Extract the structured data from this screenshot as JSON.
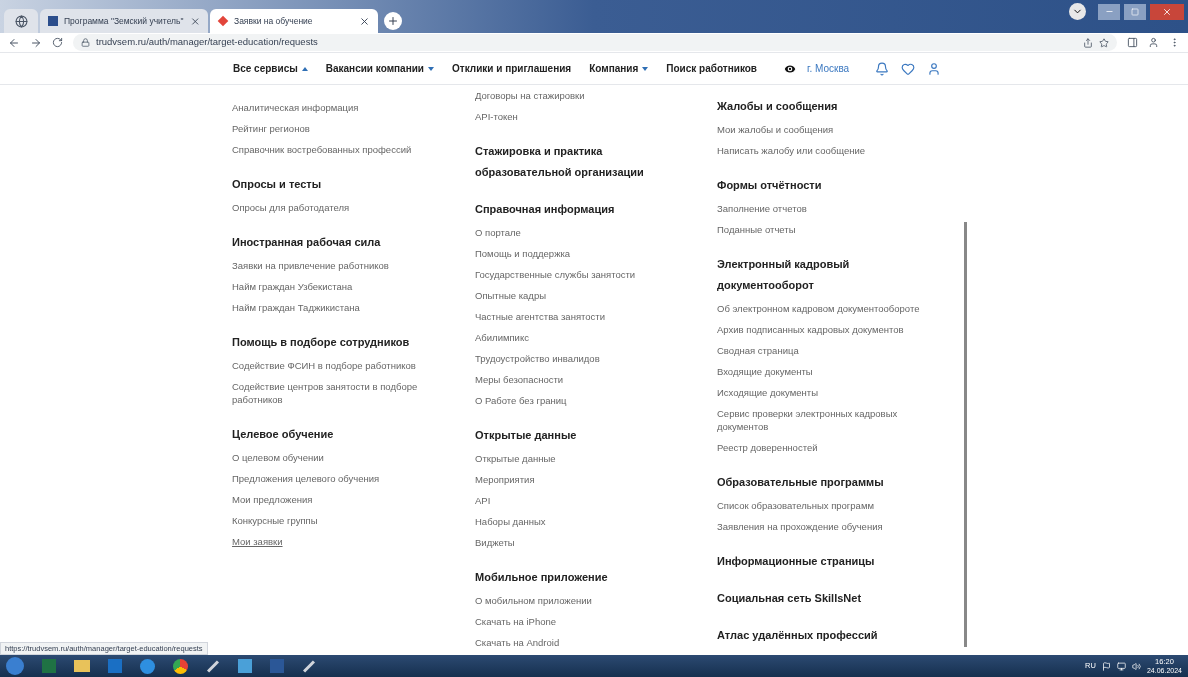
{
  "browser": {
    "tabs": [
      {
        "kind": "pinned",
        "selected": false
      },
      {
        "kind": "page",
        "title": "Программа \"Земский учитель\"",
        "selected": false
      },
      {
        "kind": "page",
        "title": "Заявки на обучение",
        "selected": true
      }
    ],
    "address": "trudvsem.ru/auth/manager/target-education/requests"
  },
  "nav": {
    "items": [
      {
        "kind": "menu",
        "label": "Все сервисы",
        "expanded": true
      },
      {
        "kind": "menu",
        "label": "Вакансии компании",
        "expanded": false
      },
      {
        "kind": "link",
        "label": "Отклики и приглашения"
      },
      {
        "kind": "menu",
        "label": "Компания",
        "expanded": false
      },
      {
        "kind": "link",
        "label": "Поиск работников"
      }
    ],
    "city": "г. Москва"
  },
  "columns": [
    [
      {
        "links": [
          {
            "label": "Аналитическая информация",
            "selected": false
          },
          {
            "label": "Рейтинг регионов",
            "selected": false
          },
          {
            "label": "Справочник востребованных профессий",
            "selected": false
          }
        ]
      },
      {
        "heading": "Опросы и тесты",
        "links": [
          {
            "label": "Опросы для работодателя",
            "selected": false
          }
        ]
      },
      {
        "heading": "Иностранная рабочая сила",
        "links": [
          {
            "label": "Заявки на привлечение работников",
            "selected": false
          },
          {
            "label": "Найм граждан Узбекистана",
            "selected": false
          },
          {
            "label": "Найм граждан Таджикистана",
            "selected": false
          }
        ]
      },
      {
        "heading": "Помощь в подборе сотрудников",
        "links": [
          {
            "label": "Содействие ФСИН в подборе работников",
            "selected": false
          },
          {
            "label": "Содействие центров занятости в подборе работников",
            "selected": false
          }
        ]
      },
      {
        "heading": "Целевое обучение",
        "links": [
          {
            "label": "О целевом обучении",
            "selected": false
          },
          {
            "label": "Предложения целевого обучения",
            "selected": false
          },
          {
            "label": "Мои предложения",
            "selected": false
          },
          {
            "label": "Конкурсные группы",
            "selected": false
          },
          {
            "label": "Мои заявки",
            "selected": true
          }
        ]
      }
    ],
    [
      {
        "links": [
          {
            "label": "Договоры на стажировки",
            "selected": false
          },
          {
            "label": "API-токен",
            "selected": false
          }
        ]
      },
      {
        "heading": "Стажировка и практика образовательной организации"
      },
      {
        "heading": "Справочная информация",
        "links": [
          {
            "label": "О портале",
            "selected": false
          },
          {
            "label": "Помощь и поддержка",
            "selected": false
          },
          {
            "label": "Государственные службы занятости",
            "selected": false
          },
          {
            "label": "Опытные кадры",
            "selected": false
          },
          {
            "label": "Частные агентства занятости",
            "selected": false
          },
          {
            "label": "Абилимпикс",
            "selected": false
          },
          {
            "label": "Трудоустройство инвалидов",
            "selected": false
          },
          {
            "label": "Меры безопасности",
            "selected": false
          },
          {
            "label": "О Работе без границ",
            "selected": false
          }
        ]
      },
      {
        "heading": "Открытые данные",
        "links": [
          {
            "label": "Открытые данные",
            "selected": false
          },
          {
            "label": "Мероприятия",
            "selected": false
          },
          {
            "label": "API",
            "selected": false
          },
          {
            "label": "Наборы данных",
            "selected": false
          },
          {
            "label": "Виджеты",
            "selected": false
          }
        ]
      },
      {
        "heading": "Мобильное приложение",
        "links": [
          {
            "label": "О мобильном приложении",
            "selected": false
          },
          {
            "label": "Скачать на iPhone",
            "selected": false
          },
          {
            "label": "Скачать на Android",
            "selected": false
          }
        ]
      }
    ],
    [
      {
        "heading": "Жалобы и сообщения",
        "links": [
          {
            "label": "Мои жалобы и сообщения",
            "selected": false
          },
          {
            "label": "Написать жалобу или сообщение",
            "selected": false
          }
        ]
      },
      {
        "heading": "Формы отчётности",
        "links": [
          {
            "label": "Заполнение отчетов",
            "selected": false
          },
          {
            "label": "Поданные отчеты",
            "selected": false
          }
        ]
      },
      {
        "heading": "Электронный кадровый документооборот",
        "links": [
          {
            "label": "Об электронном кадровом документообороте",
            "selected": false
          },
          {
            "label": "Архив подписанных кадровых документов",
            "selected": false
          },
          {
            "label": "Сводная страница",
            "selected": false
          },
          {
            "label": "Входящие документы",
            "selected": false
          },
          {
            "label": "Исходящие документы",
            "selected": false
          },
          {
            "label": "Сервис проверки электронных кадровых документов",
            "selected": false
          },
          {
            "label": "Реестр доверенностей",
            "selected": false
          }
        ]
      },
      {
        "heading": "Образовательные программы",
        "links": [
          {
            "label": "Список образовательных программ",
            "selected": false
          },
          {
            "label": "Заявления на прохождение обучения",
            "selected": false
          }
        ]
      },
      {
        "heading": "Информационные страницы"
      },
      {
        "heading": "Социальная сеть SkillsNet"
      },
      {
        "heading": "Атлас удалённых профессий"
      }
    ]
  ],
  "status_url": "https://trudvsem.ru/auth/manager/target-education/requests",
  "taskbar": {
    "language": "RU",
    "time": "16:20",
    "date": "24.06.2024"
  }
}
